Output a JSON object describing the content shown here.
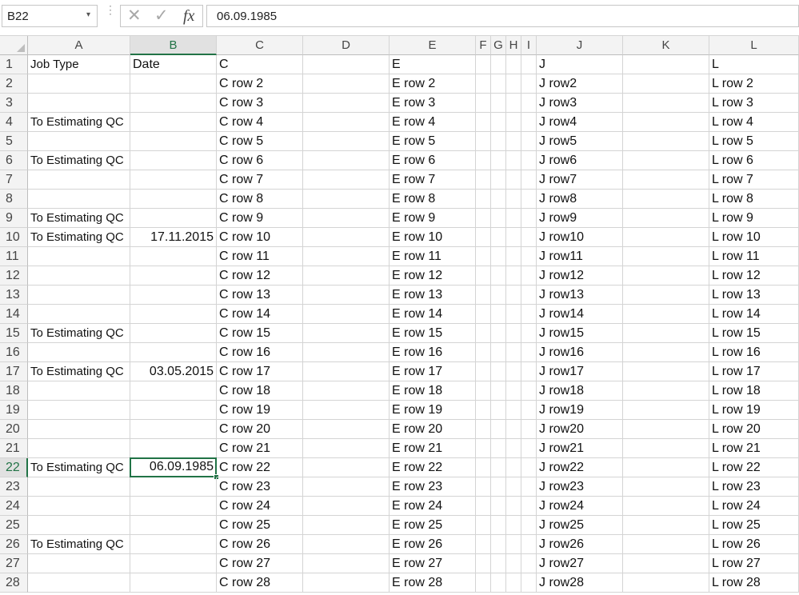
{
  "formula_bar": {
    "name_box": "B22",
    "name_box_arrow": "▾",
    "more_icon": "⋮",
    "cancel_icon": "✕",
    "enter_icon": "✓",
    "fx_label": "fx",
    "formula_value": "06.09.1985"
  },
  "sheet": {
    "columns": [
      "A",
      "B",
      "C",
      "D",
      "E",
      "F",
      "G",
      "H",
      "I",
      "J",
      "K",
      "L"
    ],
    "selected_column": "B",
    "selected_row": 22,
    "selection_color": "#217346",
    "rows": [
      {
        "n": "1",
        "a": "Job Type",
        "b": "Date",
        "c": "C",
        "e": "E",
        "j": "J",
        "l": "L"
      },
      {
        "n": "2",
        "a": "",
        "b": "",
        "c": "C row 2",
        "e": "E row 2",
        "j": "J row2",
        "l": "L row 2"
      },
      {
        "n": "3",
        "a": "",
        "b": "",
        "c": "C row 3",
        "e": "E row 3",
        "j": "J row3",
        "l": "L row 3"
      },
      {
        "n": "4",
        "a": "To Estimating QC",
        "b": "",
        "c": "C row 4",
        "e": "E row 4",
        "j": "J row4",
        "l": "L row 4"
      },
      {
        "n": "5",
        "a": "",
        "b": "",
        "c": "C row 5",
        "e": "E row 5",
        "j": "J row5",
        "l": "L row 5"
      },
      {
        "n": "6",
        "a": "To Estimating QC",
        "b": "",
        "c": "C row 6",
        "e": "E row 6",
        "j": "J row6",
        "l": "L row 6"
      },
      {
        "n": "7",
        "a": "",
        "b": "",
        "c": "C row 7",
        "e": "E row 7",
        "j": "J row7",
        "l": "L row 7"
      },
      {
        "n": "8",
        "a": "",
        "b": "",
        "c": "C row 8",
        "e": "E row 8",
        "j": "J row8",
        "l": "L row 8"
      },
      {
        "n": "9",
        "a": "To Estimating QC",
        "b": "",
        "c": "C row 9",
        "e": "E row 9",
        "j": "J row9",
        "l": "L row 9"
      },
      {
        "n": "10",
        "a": "To Estimating QC",
        "b": "17.11.2015",
        "c": "C row 10",
        "e": "E row 10",
        "j": "J row10",
        "l": "L row 10"
      },
      {
        "n": "11",
        "a": "",
        "b": "",
        "c": "C row 11",
        "e": "E row 11",
        "j": "J row11",
        "l": "L row 11"
      },
      {
        "n": "12",
        "a": "",
        "b": "",
        "c": "C row 12",
        "e": "E row 12",
        "j": "J row12",
        "l": "L row 12"
      },
      {
        "n": "13",
        "a": "",
        "b": "",
        "c": "C row 13",
        "e": "E row 13",
        "j": "J row13",
        "l": "L row 13"
      },
      {
        "n": "14",
        "a": "",
        "b": "",
        "c": "C row 14",
        "e": "E row 14",
        "j": "J row14",
        "l": "L row 14"
      },
      {
        "n": "15",
        "a": "To Estimating QC",
        "b": "",
        "c": "C row 15",
        "e": "E row 15",
        "j": "J row15",
        "l": "L row 15"
      },
      {
        "n": "16",
        "a": "",
        "b": "",
        "c": "C row 16",
        "e": "E row 16",
        "j": "J row16",
        "l": "L row 16"
      },
      {
        "n": "17",
        "a": "To Estimating QC",
        "b": "03.05.2015",
        "c": "C row 17",
        "e": "E row 17",
        "j": "J row17",
        "l": "L row 17"
      },
      {
        "n": "18",
        "a": "",
        "b": "",
        "c": "C row 18",
        "e": "E row 18",
        "j": "J row18",
        "l": "L row 18"
      },
      {
        "n": "19",
        "a": "",
        "b": "",
        "c": "C row 19",
        "e": "E row 19",
        "j": "J row19",
        "l": "L row 19"
      },
      {
        "n": "20",
        "a": "",
        "b": "",
        "c": "C row 20",
        "e": "E row 20",
        "j": "J row20",
        "l": "L row 20"
      },
      {
        "n": "21",
        "a": "",
        "b": "",
        "c": "C row 21",
        "e": "E row 21",
        "j": "J row21",
        "l": "L row 21"
      },
      {
        "n": "22",
        "a": "To Estimating QC",
        "b": "06.09.1985",
        "c": "C row 22",
        "e": "E row 22",
        "j": "J row22",
        "l": "L row 22"
      },
      {
        "n": "23",
        "a": "",
        "b": "",
        "c": "C row 23",
        "e": "E row 23",
        "j": "J row23",
        "l": "L row 23"
      },
      {
        "n": "24",
        "a": "",
        "b": "",
        "c": "C row 24",
        "e": "E row 24",
        "j": "J row24",
        "l": "L row 24"
      },
      {
        "n": "25",
        "a": "",
        "b": "",
        "c": "C row 25",
        "e": "E row 25",
        "j": "J row25",
        "l": "L row 25"
      },
      {
        "n": "26",
        "a": "To Estimating QC",
        "b": "",
        "c": "C row 26",
        "e": "E row 26",
        "j": "J row26",
        "l": "L row 26"
      },
      {
        "n": "27",
        "a": "",
        "b": "",
        "c": "C row 27",
        "e": "E row 27",
        "j": "J row27",
        "l": "L row 27"
      },
      {
        "n": "28",
        "a": "",
        "b": "",
        "c": "C row 28",
        "e": "E row 28",
        "j": "J row28",
        "l": "L row 28"
      }
    ]
  }
}
